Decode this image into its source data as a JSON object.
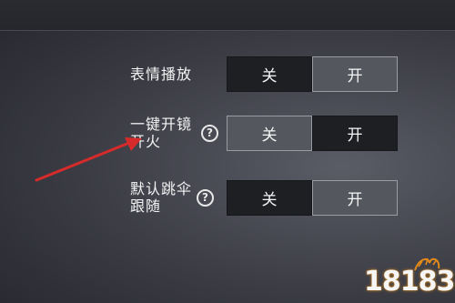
{
  "settings": {
    "rows": [
      {
        "label_line1": "表情播放",
        "label_line2": "",
        "off_label": "关",
        "on_label": "开",
        "selected": "on",
        "has_help": false
      },
      {
        "label_line1": "一键开镜",
        "label_line2": "开火",
        "off_label": "关",
        "on_label": "开",
        "selected": "off",
        "has_help": true
      },
      {
        "label_line1": "默认跳伞",
        "label_line2": "跟随",
        "off_label": "关",
        "on_label": "开",
        "selected": "on",
        "has_help": true
      }
    ],
    "help_glyph": "?"
  },
  "annotation": {
    "icon": "red-arrow",
    "color": "#d62b2b"
  },
  "watermark": {
    "text": "18183",
    "accent": "#e28a1a"
  }
}
